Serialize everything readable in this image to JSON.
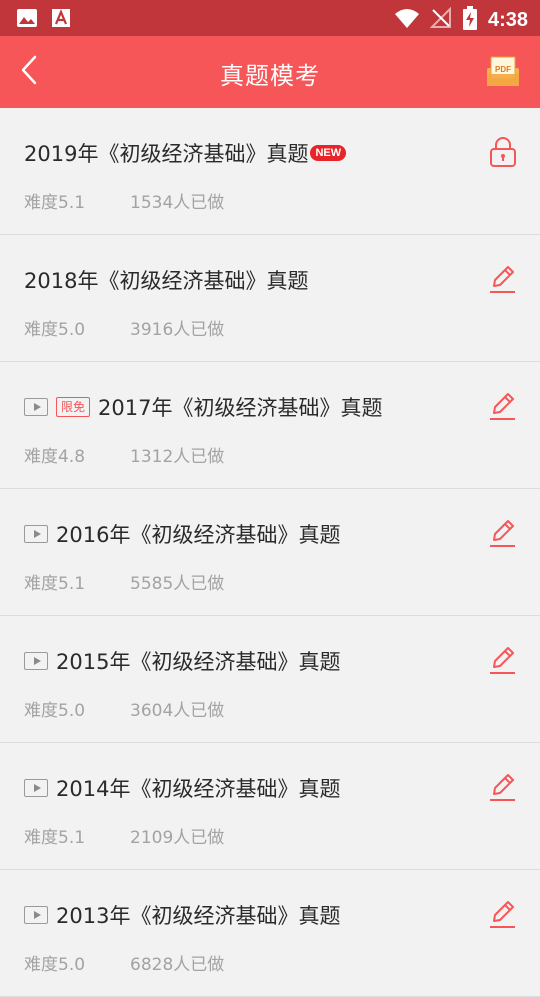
{
  "status_bar": {
    "time": "4:38",
    "icons": [
      "image-icon",
      "text-icon",
      "wifi-icon",
      "no-signal-icon",
      "battery-charging-icon"
    ]
  },
  "header": {
    "title": "真题模考",
    "back_icon": "back-icon",
    "pdf_icon": "pdf-icon",
    "pdf_icon_text": "PDF"
  },
  "colors": {
    "status_bar": "#c0363a",
    "app_bar": "#f65657",
    "accent": "#f65657",
    "background": "#f2f2f2"
  },
  "exams": [
    {
      "title": "2019年《初级经济基础》真题",
      "badge": "NEW",
      "free_label": "",
      "video": false,
      "difficulty": "难度5.1",
      "count": "1534人已做",
      "action": "lock-icon"
    },
    {
      "title": "2018年《初级经济基础》真题",
      "badge": "",
      "free_label": "",
      "video": false,
      "difficulty": "难度5.0",
      "count": "3916人已做",
      "action": "edit-icon"
    },
    {
      "title": "2017年《初级经济基础》真题",
      "badge": "",
      "free_label": "限免",
      "video": true,
      "difficulty": "难度4.8",
      "count": "1312人已做",
      "action": "edit-icon"
    },
    {
      "title": "2016年《初级经济基础》真题",
      "badge": "",
      "free_label": "",
      "video": true,
      "difficulty": "难度5.1",
      "count": "5585人已做",
      "action": "edit-icon"
    },
    {
      "title": "2015年《初级经济基础》真题",
      "badge": "",
      "free_label": "",
      "video": true,
      "difficulty": "难度5.0",
      "count": "3604人已做",
      "action": "edit-icon"
    },
    {
      "title": "2014年《初级经济基础》真题",
      "badge": "",
      "free_label": "",
      "video": true,
      "difficulty": "难度5.1",
      "count": "2109人已做",
      "action": "edit-icon"
    },
    {
      "title": "2013年《初级经济基础》真题",
      "badge": "",
      "free_label": "",
      "video": true,
      "difficulty": "难度5.0",
      "count": "6828人已做",
      "action": "edit-icon"
    }
  ]
}
